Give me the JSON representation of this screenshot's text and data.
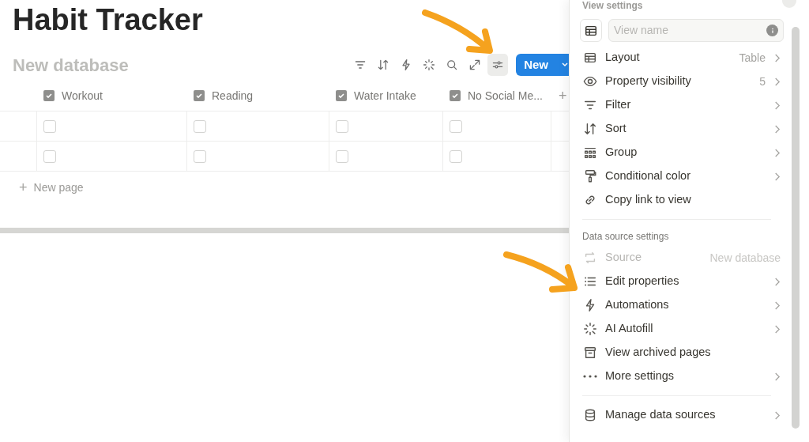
{
  "page": {
    "title": "Habit Tracker"
  },
  "database": {
    "title_placeholder": "New database",
    "toolbar": [
      {
        "kind": "filter",
        "selected": false
      },
      {
        "kind": "sort",
        "selected": false
      },
      {
        "kind": "bolt",
        "selected": false
      },
      {
        "kind": "sparkle",
        "selected": false
      },
      {
        "kind": "search",
        "selected": false
      },
      {
        "kind": "expand",
        "selected": false
      },
      {
        "kind": "sliders",
        "selected": true
      }
    ],
    "new_button": "New",
    "columns": [
      {
        "label": "Workout"
      },
      {
        "label": "Reading"
      },
      {
        "label": "Water Intake"
      },
      {
        "label": "No Social Me..."
      }
    ],
    "add_column": "+",
    "rows": [
      {
        "cells": [
          {
            "checked": false
          },
          {
            "checked": false
          },
          {
            "checked": false
          },
          {
            "checked": false
          }
        ]
      },
      {
        "cells": [
          {
            "checked": false
          },
          {
            "checked": false
          },
          {
            "checked": false
          },
          {
            "checked": false
          }
        ]
      }
    ],
    "new_page": {
      "icon": "+",
      "label": "New page"
    }
  },
  "panel": {
    "title": "View settings",
    "view_name_placeholder": "View name",
    "sections": [
      {
        "items": [
          {
            "kind": "table",
            "label": "Layout",
            "value": "Table",
            "chevron": true,
            "disabled": false
          },
          {
            "kind": "eye",
            "label": "Property visibility",
            "value": "5",
            "chevron": true,
            "disabled": false
          },
          {
            "kind": "filter",
            "label": "Filter",
            "chevron": true,
            "disabled": false
          },
          {
            "kind": "sort",
            "label": "Sort",
            "chevron": true,
            "disabled": false
          },
          {
            "kind": "group",
            "label": "Group",
            "chevron": true,
            "disabled": false
          },
          {
            "kind": "roller",
            "label": "Conditional color",
            "chevron": true,
            "disabled": false
          },
          {
            "kind": "link",
            "label": "Copy link to view",
            "chevron": false,
            "disabled": false
          }
        ]
      },
      {
        "heading": "Data source settings",
        "items": [
          {
            "kind": "source",
            "label": "Source",
            "value": "New database",
            "chevron": false,
            "disabled": true
          },
          {
            "kind": "list",
            "label": "Edit properties",
            "chevron": true,
            "disabled": false
          },
          {
            "kind": "bolt",
            "label": "Automations",
            "chevron": true,
            "disabled": false
          },
          {
            "kind": "sparkle",
            "label": "AI Autofill",
            "chevron": true,
            "disabled": false
          },
          {
            "kind": "archive",
            "label": "View archived pages",
            "chevron": false,
            "disabled": false
          },
          {
            "kind": "dots",
            "label": "More settings",
            "chevron": true,
            "disabled": false
          }
        ]
      },
      {
        "items": [
          {
            "kind": "database",
            "label": "Manage data sources",
            "chevron": true,
            "disabled": false
          }
        ]
      }
    ]
  }
}
